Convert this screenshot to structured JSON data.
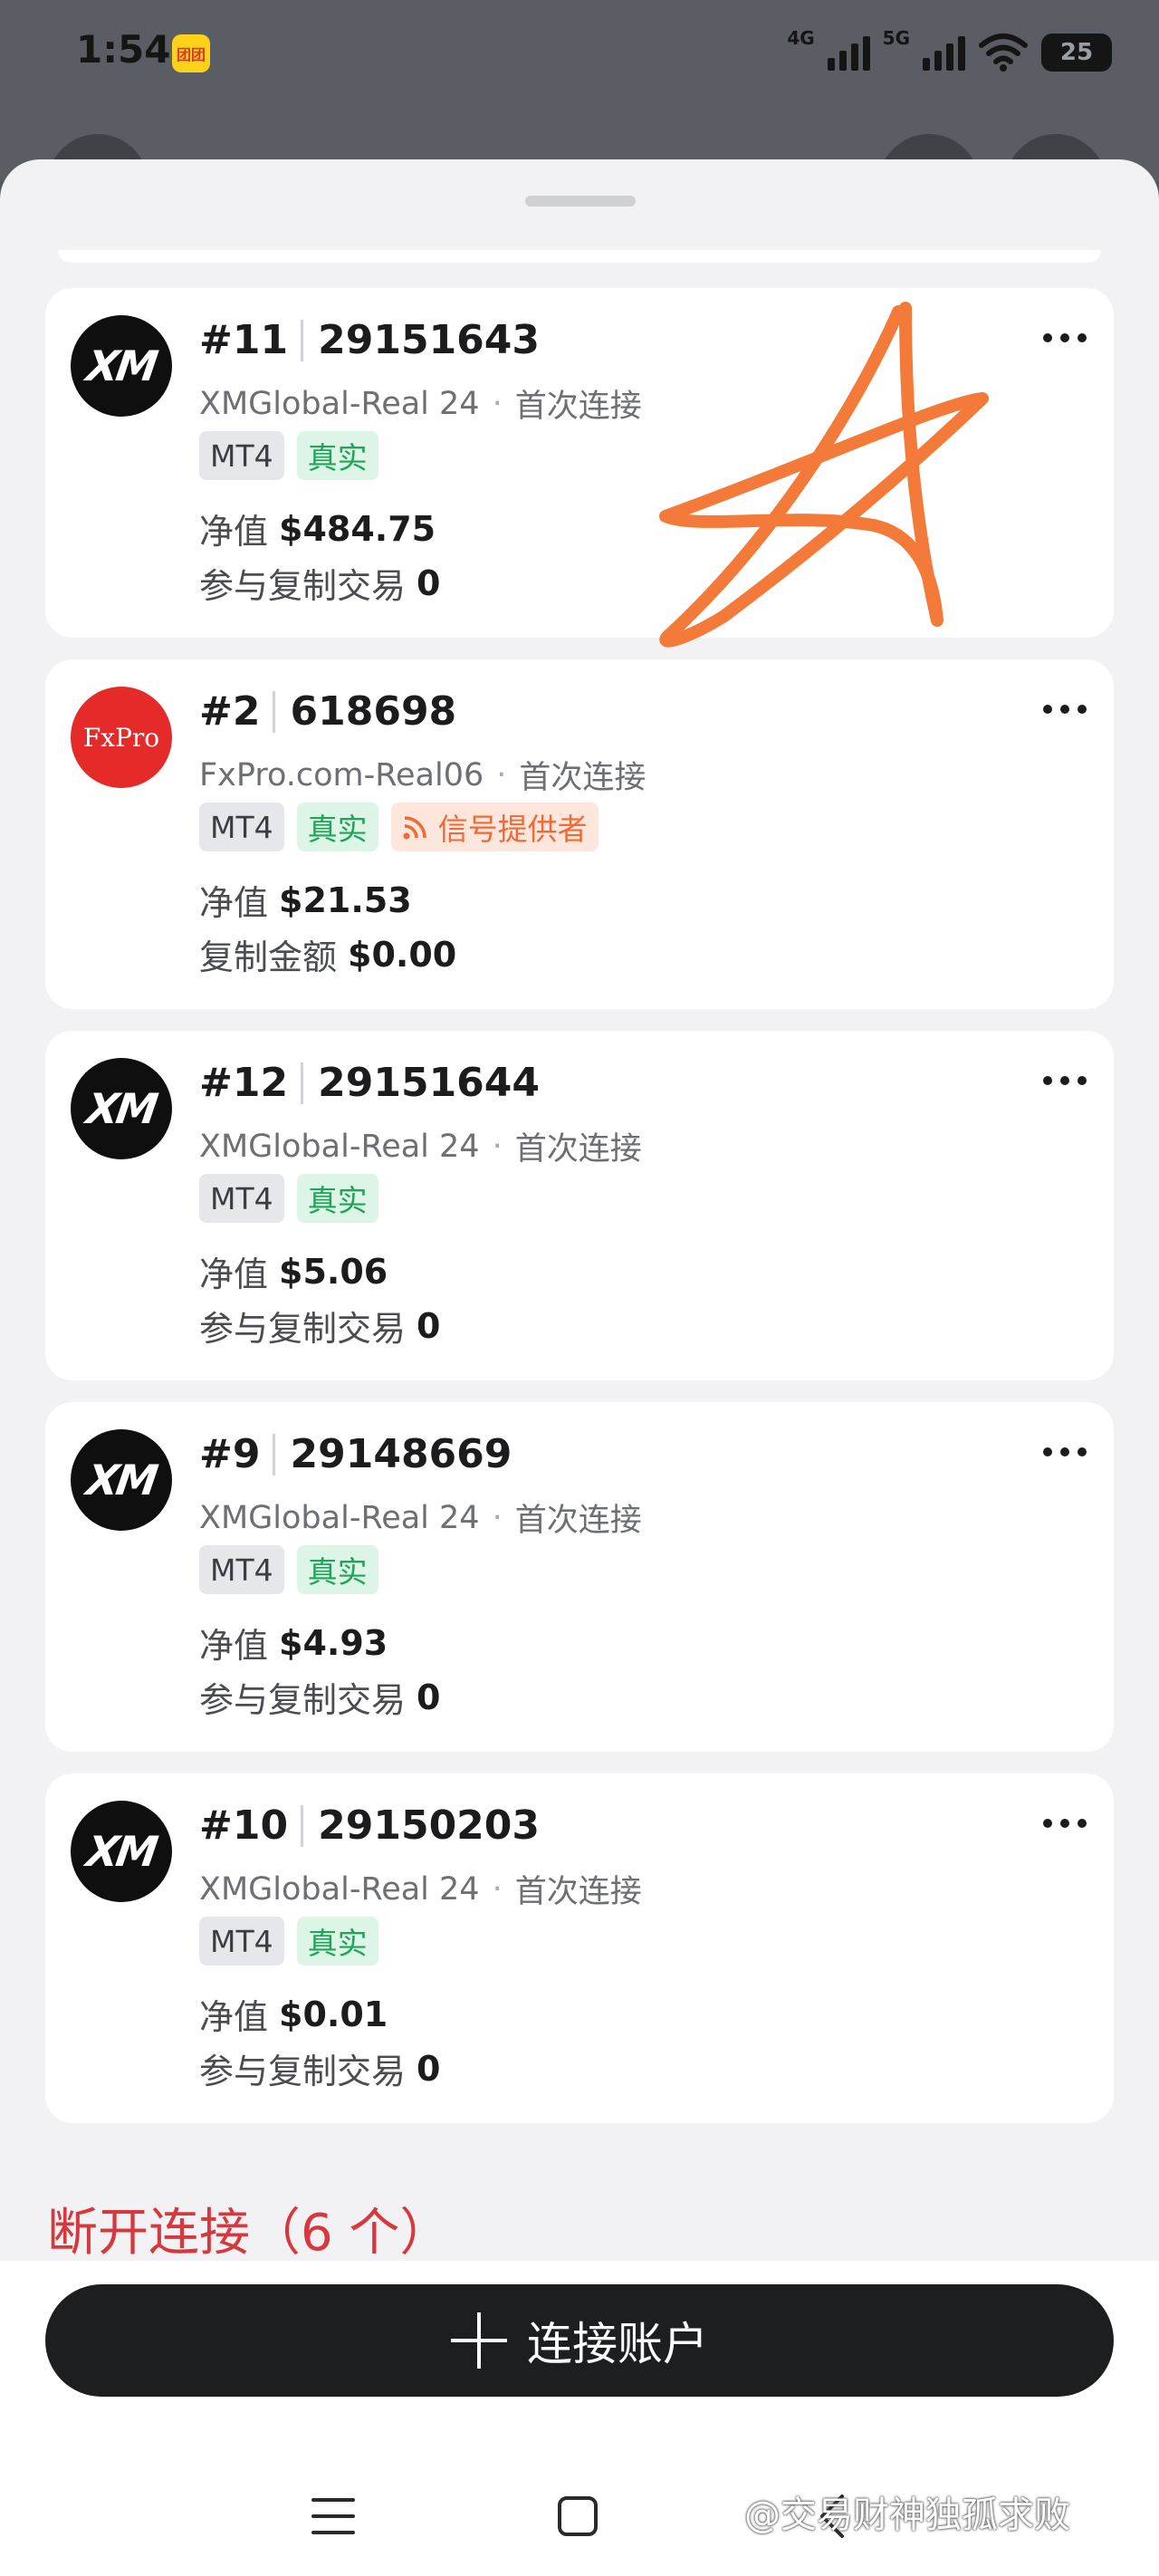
{
  "status_bar": {
    "time": "1:54",
    "app_icon_text": "团团",
    "network_1": "4G",
    "network_2": "5G",
    "battery": "25"
  },
  "accounts": [
    {
      "logo_icon": "xm-logo",
      "logo_text": "XM",
      "number": "#11",
      "login": "29151643",
      "server": "XMGlobal-Real 24",
      "connection": "首次连接",
      "platform": "MT4",
      "type": "真实",
      "equity_label": "净值",
      "equity": "$484.75",
      "second_label": "参与复制交易",
      "second_value": "0"
    },
    {
      "logo_icon": "fxpro-logo",
      "logo_text": "FxPro",
      "number": "#2",
      "login": "618698",
      "server": "FxPro.com-Real06",
      "connection": "首次连接",
      "platform": "MT4",
      "type": "真实",
      "signal_tag": "信号提供者",
      "equity_label": "净值",
      "equity": "$21.53",
      "second_label": "复制金额",
      "second_value": "$0.00"
    },
    {
      "logo_icon": "xm-logo",
      "logo_text": "XM",
      "number": "#12",
      "login": "29151644",
      "server": "XMGlobal-Real 24",
      "connection": "首次连接",
      "platform": "MT4",
      "type": "真实",
      "equity_label": "净值",
      "equity": "$5.06",
      "second_label": "参与复制交易",
      "second_value": "0"
    },
    {
      "logo_icon": "xm-logo",
      "logo_text": "XM",
      "number": "#9",
      "login": "29148669",
      "server": "XMGlobal-Real 24",
      "connection": "首次连接",
      "platform": "MT4",
      "type": "真实",
      "equity_label": "净值",
      "equity": "$4.93",
      "second_label": "参与复制交易",
      "second_value": "0"
    },
    {
      "logo_icon": "xm-logo",
      "logo_text": "XM",
      "number": "#10",
      "login": "29150203",
      "server": "XMGlobal-Real 24",
      "connection": "首次连接",
      "platform": "MT4",
      "type": "真实",
      "equity_label": "净值",
      "equity": "$0.01",
      "second_label": "参与复制交易",
      "second_value": "0"
    }
  ],
  "disconnected_heading": "断开连接（6 个）",
  "connect_button_label": "连接账户",
  "watermark": "@交易财神独孤求败",
  "colors": {
    "real_tag": "#1fa458",
    "signal_tag": "#ef6a36",
    "disconnected": "#d6393d",
    "star_doodle": "#f47a3a"
  }
}
